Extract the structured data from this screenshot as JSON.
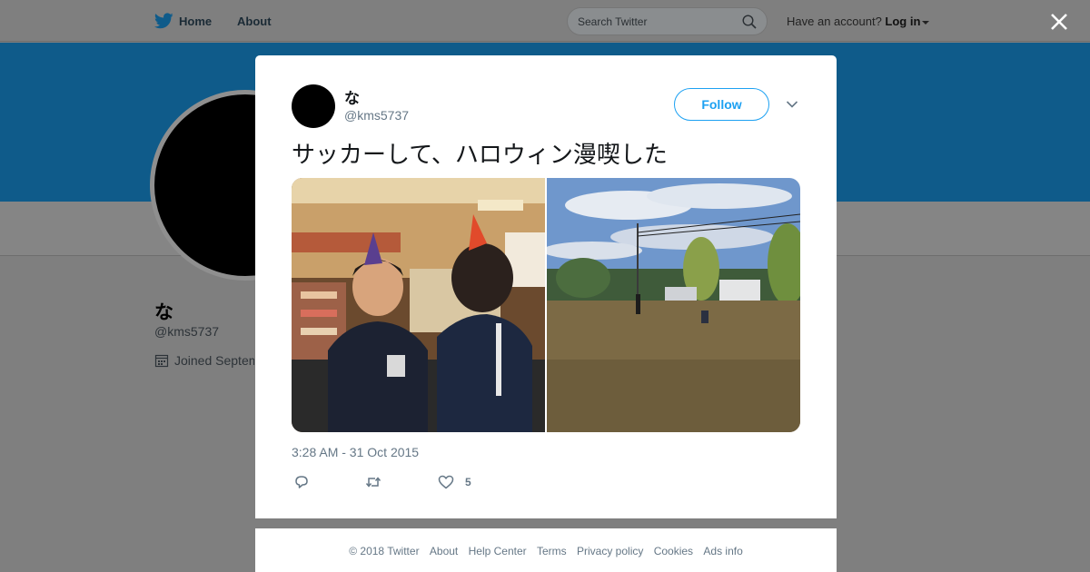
{
  "nav": {
    "home_label": "Home",
    "about_label": "About",
    "search_placeholder": "Search Twitter",
    "have_account": "Have an account?",
    "login_label": "Log in"
  },
  "profile": {
    "name": "な",
    "handle": "@kms5737",
    "joined": "Joined September"
  },
  "tweet": {
    "author_name": "な",
    "author_handle": "@kms5737",
    "follow_label": "Follow",
    "text": "サッカーして、ハロウィン漫喫した",
    "timestamp": "3:28 AM - 31 Oct 2015",
    "like_count": "5"
  },
  "footer": {
    "copyright": "© 2018 Twitter",
    "links": [
      "About",
      "Help Center",
      "Terms",
      "Privacy policy",
      "Cookies",
      "Ads info"
    ]
  },
  "colors": {
    "brand": "#1da1f2",
    "banner": "#0f5b8a",
    "overlay_background": "#7f7f7f"
  },
  "icons": {
    "logo": "twitter-bird-icon",
    "search": "search-icon",
    "close": "close-icon",
    "reply": "reply-icon",
    "retweet": "retweet-icon",
    "like": "heart-icon"
  }
}
